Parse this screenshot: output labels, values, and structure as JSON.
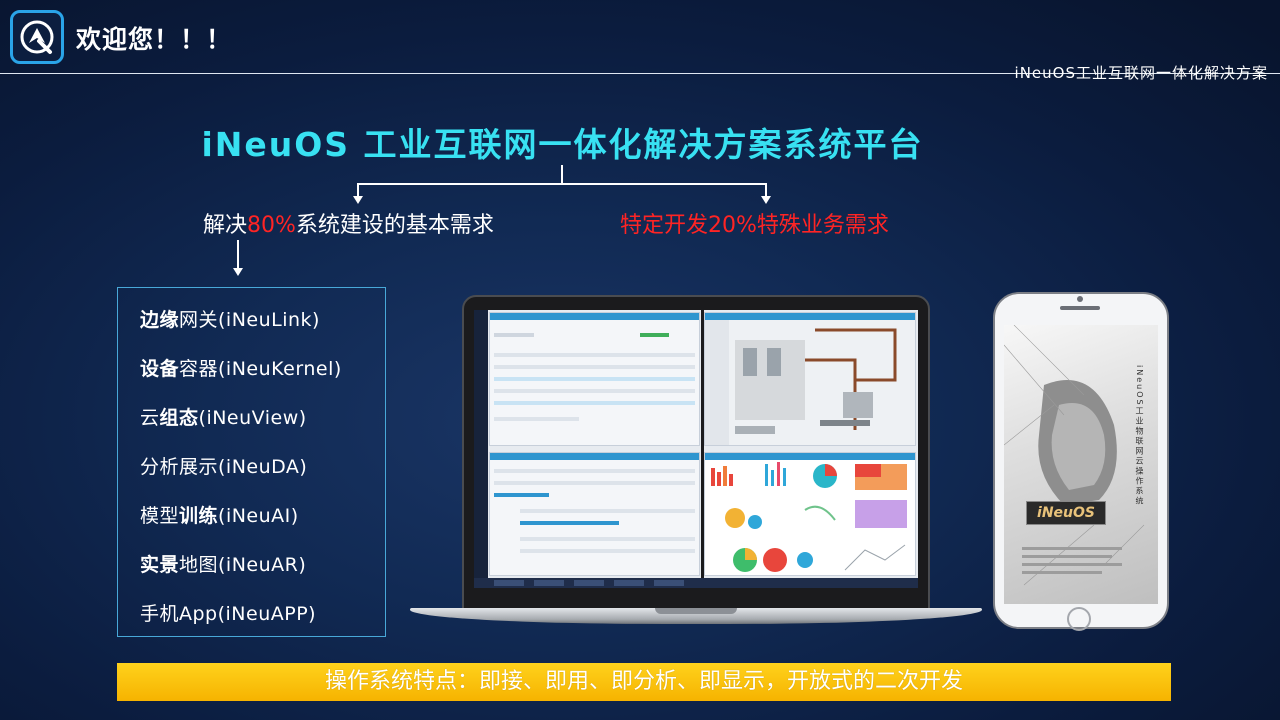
{
  "header": {
    "welcome": "欢迎您！！！",
    "subtitle": "iNeuOS工业互联网一体化解决方案"
  },
  "title": "iNeuOS 工业互联网一体化解决方案系统平台",
  "branches": {
    "left_prefix": "解决",
    "left_highlight": "80%",
    "left_suffix": "系统建设的基本需求",
    "right": "特定开发20%特殊业务需求"
  },
  "modules": [
    {
      "bold": "边缘",
      "rest": "网关(iNeuLink)"
    },
    {
      "bold": "设备",
      "rest": "容器(iNeuKernel)"
    },
    {
      "pre": "云",
      "bold": "组态",
      "rest": "(iNeuView)"
    },
    {
      "rest": "分析展示(iNeuDA)"
    },
    {
      "pre": "模型",
      "bold": "训练",
      "rest": "(iNeuAI)"
    },
    {
      "bold": "实景",
      "rest": "地图(iNeuAR)"
    },
    {
      "rest": "手机App(iNeuAPP)"
    }
  ],
  "phone": {
    "brand": "iNeuOS",
    "vertical_text": "iNeuOS工业物联网云操作系统"
  },
  "banner": "操作系统特点：即接、即用、即分析、即显示，开放式的二次开发",
  "colors": {
    "title": "#38e1f2",
    "highlight_red": "#ff2424",
    "banner": "#f6b300",
    "box_border": "#48a8d8"
  },
  "icons": [
    "logo-icon"
  ]
}
